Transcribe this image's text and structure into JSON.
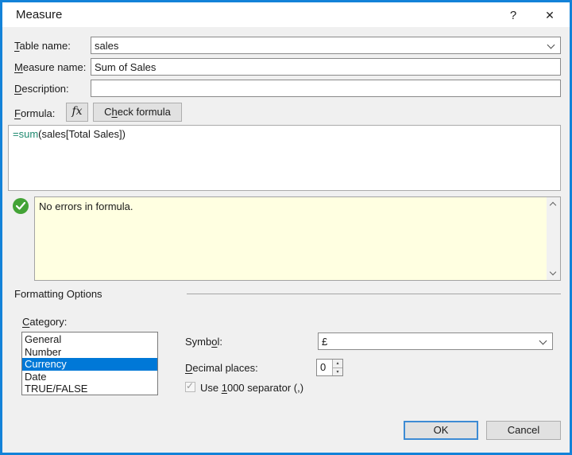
{
  "window": {
    "title": "Measure",
    "help_glyph": "?",
    "close_glyph": "✕"
  },
  "colors": {
    "accent_border": "#1382D8",
    "selection_blue": "#0078D7",
    "formula_keyword": "#1F8A70",
    "message_bg": "#FFFFE1",
    "success_green": "#43A336"
  },
  "form": {
    "table_name": {
      "label": {
        "text": "Table name:",
        "ul": 0
      },
      "value": "sales"
    },
    "measure_name": {
      "label": {
        "text": "Measure name:",
        "ul": 0
      },
      "value": "Sum of Sales"
    },
    "description": {
      "label": {
        "text": "Description:",
        "ul": 0
      },
      "value": ""
    },
    "formula": {
      "label": {
        "text": "Formula:",
        "ul": 0
      },
      "fx_button_glyph": "fx",
      "check_button": {
        "text": "Check formula",
        "ul": 1
      },
      "value_keyword": "=sum",
      "value_rest": "(sales[Total Sales])"
    },
    "validation": {
      "message": "No errors in formula.",
      "status": "success"
    }
  },
  "formatting": {
    "section_title": "Formatting Options",
    "category": {
      "label": {
        "text": "Category:",
        "ul": 0
      },
      "options": [
        "General",
        "Number",
        "Currency",
        "Date",
        "TRUE/FALSE"
      ],
      "selected": "Currency",
      "selected_index": 2
    },
    "symbol": {
      "label": {
        "text": "Symbol:",
        "ul": 4
      },
      "value": "£"
    },
    "decimal_places": {
      "label": {
        "text": "Decimal places:",
        "ul": 0
      },
      "value": "0"
    },
    "thousand_separator": {
      "label": {
        "text": "Use 1000 separator (,)",
        "ul": 4
      },
      "checked": true,
      "enabled": false,
      "check_glyph": "✓"
    }
  },
  "buttons": {
    "ok": "OK",
    "cancel": "Cancel"
  }
}
